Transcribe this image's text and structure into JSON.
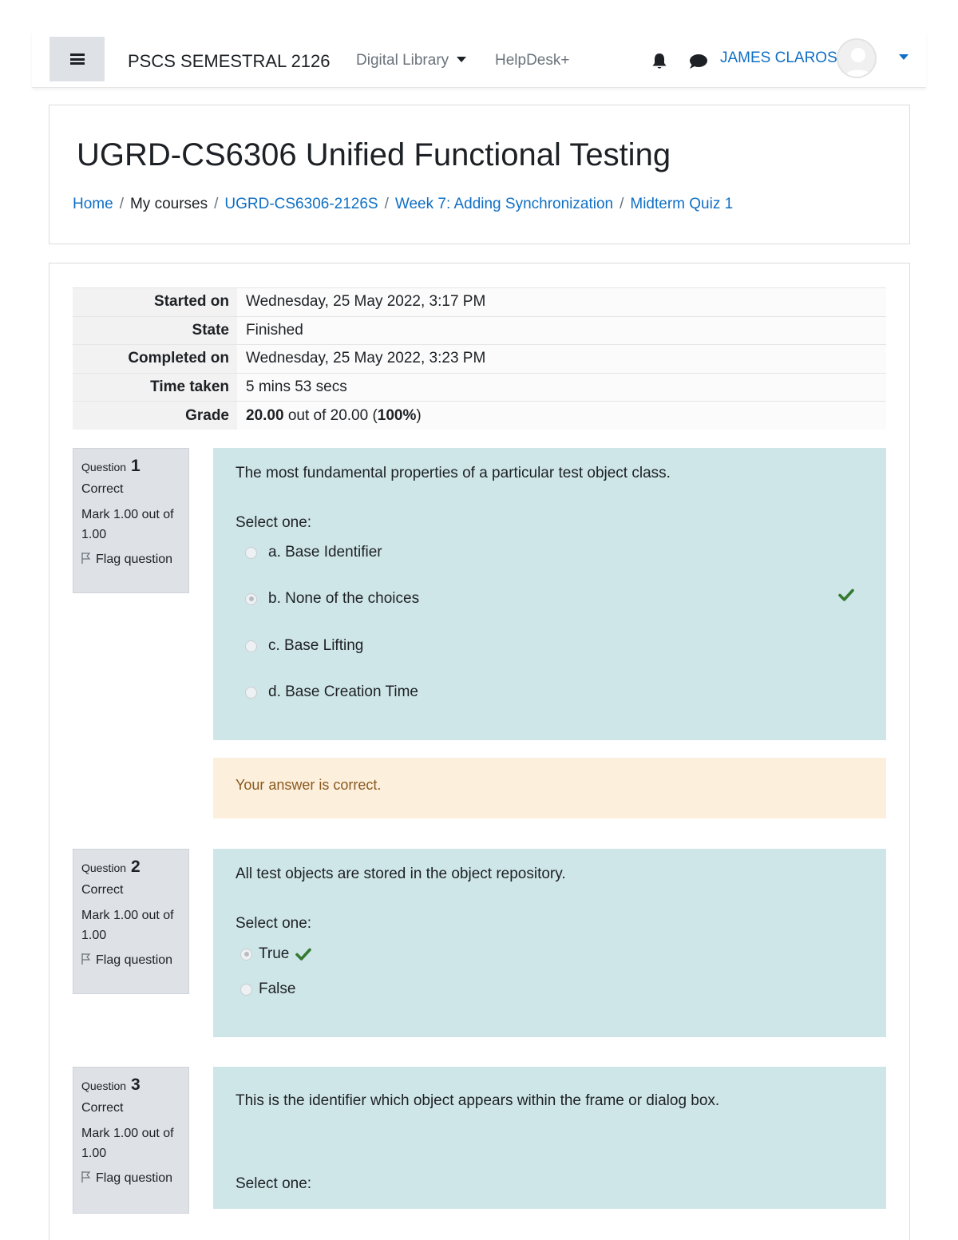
{
  "navbar": {
    "site_name": "PSCS SEMESTRAL 2126",
    "links": [
      {
        "label": "Digital Library"
      },
      {
        "label": "HelpDesk+"
      }
    ],
    "user_name": "JAMES CLAROS"
  },
  "page": {
    "course_title": "UGRD-CS6306 Unified Functional Testing",
    "breadcrumb": [
      "Home",
      "My courses",
      "UGRD-CS6306-2126S",
      "Week 7: Adding Synchronization",
      "Midterm Quiz 1"
    ],
    "breadcrumb_sep": "/"
  },
  "summary": {
    "rows": [
      {
        "label": "Started on",
        "value": "Wednesday, 25 May 2022, 3:17 PM"
      },
      {
        "label": "State",
        "value": "Finished"
      },
      {
        "label": "Completed on",
        "value": "Wednesday, 25 May 2022, 3:23 PM"
      },
      {
        "label": "Time taken",
        "value": "5 mins 53 secs"
      }
    ],
    "grade_label": "Grade",
    "grade_score": "20.00",
    "grade_out_of": " out of 20.00 (",
    "grade_percent": "100%",
    "grade_close": ")"
  },
  "questions": [
    {
      "prefix": "Question",
      "number": "1",
      "state": "Correct",
      "mark": "Mark 1.00 out of 1.00",
      "flag": "Flag question",
      "text": "The most fundamental properties of a particular test object class.",
      "select_label": "Select one:",
      "options": [
        {
          "label": "a. Base Identifier",
          "checked": false
        },
        {
          "label": "b. None of the choices",
          "checked": true
        },
        {
          "label": "c. Base Lifting",
          "checked": false
        },
        {
          "label": "d. Base Creation Time",
          "checked": false
        }
      ],
      "feedback": "Your answer is correct."
    },
    {
      "prefix": "Question",
      "number": "2",
      "state": "Correct",
      "mark": "Mark 1.00 out of 1.00",
      "flag": "Flag question",
      "text": "All test objects are stored in the object repository.",
      "select_label": "Select one:",
      "options": [
        {
          "label": "True",
          "checked": true
        },
        {
          "label": "False",
          "checked": false
        }
      ]
    },
    {
      "prefix": "Question",
      "number": "3",
      "state": "Correct",
      "mark": "Mark 1.00 out of 1.00",
      "flag": "Flag question",
      "text": "This is the identifier which object appears within the frame  or dialog box.",
      "select_label": "Select one:"
    }
  ],
  "colors": {
    "link": "#0f6fc5",
    "question_bg": "#cfe6e8",
    "feedback_bg": "#fcefdc",
    "correct_check": "#357a32",
    "info_bg": "#dee2e6"
  },
  "icons": [
    "hamburger-icon",
    "bell-icon",
    "chat-icon",
    "avatar-icon",
    "chevron-down-icon",
    "flag-icon",
    "check-icon"
  ]
}
